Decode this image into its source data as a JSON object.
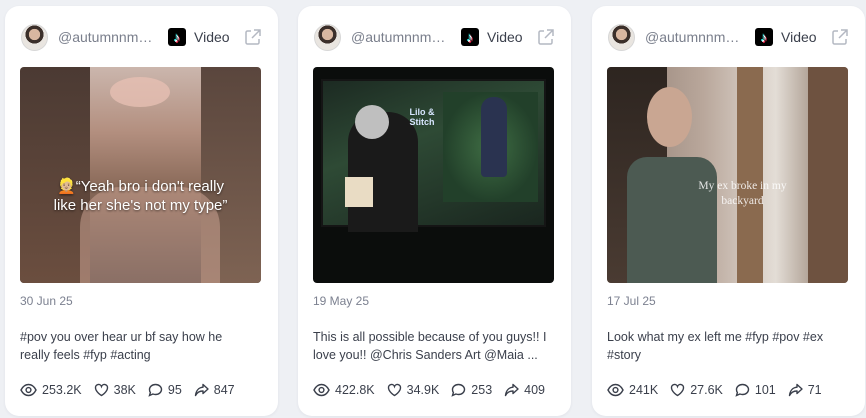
{
  "cards": [
    {
      "handle": "@autumnnmo...",
      "platform_label": "Video",
      "date": "30 Jun 25",
      "caption_line1": "#pov you over hear ur bf say how he",
      "caption_line2": "really feels #fyp #acting",
      "overlay_text": "👱🏼“Yeah bro i don't really like her she's not my type”",
      "views": "253.2K",
      "likes": "38K",
      "comments": "95",
      "shares": "847"
    },
    {
      "handle": "@autumnnmo...",
      "platform_label": "Video",
      "date": "19 May 25",
      "caption_line1": "This is all possible because of you guys!! I",
      "caption_line2": "love you!! @Chris Sanders Art @Maia ...",
      "overlay_text": "Lilo & Stitch",
      "views": "422.8K",
      "likes": "34.9K",
      "comments": "253",
      "shares": "409"
    },
    {
      "handle": "@autumnnmo...",
      "platform_label": "Video",
      "date": "17 Jul 25",
      "caption_line1": "Look what my ex left me #fyp #pov #ex",
      "caption_line2": "#story",
      "overlay_text": "My ex broke in my backyard",
      "views": "241K",
      "likes": "27.6K",
      "comments": "101",
      "shares": "71"
    }
  ],
  "icons": {
    "platform": "tiktok-icon",
    "external": "external-link-icon",
    "views": "eye-icon",
    "likes": "heart-icon",
    "comments": "comment-icon",
    "shares": "share-icon"
  },
  "colors": {
    "background": "#eef0f4",
    "card": "#ffffff",
    "text": "#3a3f4b",
    "muted": "#7c8190"
  }
}
